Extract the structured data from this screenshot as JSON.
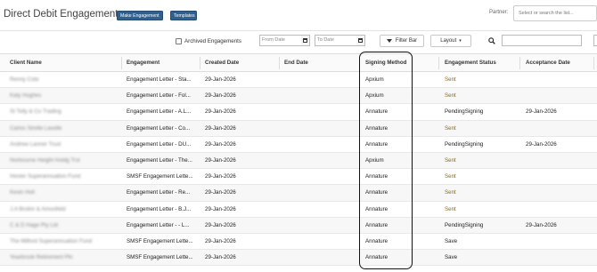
{
  "header": {
    "title": "Direct Debit Engagements",
    "make_engagement_label": "Make Engagement",
    "templates_label": "Templates",
    "partner_label": "Partner:",
    "partner_placeholder": "Select or search the list..."
  },
  "toolbar": {
    "archived_label": "Archived Engagements",
    "archived_checked": false,
    "from_date_placeholder": "From Date",
    "to_date_placeholder": "To Date",
    "filter_bar_label": "Filter Bar",
    "layout_label": "Layout",
    "search_value": ""
  },
  "table": {
    "columns": [
      "Client Name",
      "Engagement",
      "Created Date",
      "End Date",
      "Signing Method",
      "Engagement Status",
      "Acceptance Date"
    ],
    "rows": [
      {
        "client": "Renny Cola",
        "engagement": "Engagement Letter - Sta...",
        "created": "29-Jan-2026",
        "end": "",
        "signing": "Apxium",
        "status": "Sent",
        "acceptance": ""
      },
      {
        "client": "Katy Hughes",
        "engagement": "Engagement Letter - Fol...",
        "created": "29-Jan-2026",
        "end": "",
        "signing": "Apxium",
        "status": "Sent",
        "acceptance": ""
      },
      {
        "client": "St Tolly & Co Trading",
        "engagement": "Engagement Letter - A.L...",
        "created": "29-Jan-2026",
        "end": "",
        "signing": "Annature",
        "status": "PendingSigning",
        "acceptance": "29-Jan-2026"
      },
      {
        "client": "Carlos Strelle Lavelle",
        "engagement": "Engagement Letter - Co...",
        "created": "29-Jan-2026",
        "end": "",
        "signing": "Annature",
        "status": "Sent",
        "acceptance": ""
      },
      {
        "client": "Andrew Lanner Trust",
        "engagement": "Engagement Letter - DU...",
        "created": "29-Jan-2026",
        "end": "",
        "signing": "Annature",
        "status": "PendingSigning",
        "acceptance": "29-Jan-2026"
      },
      {
        "client": "Norbourne Height Holdg Trst",
        "engagement": "Engagement Letter - The...",
        "created": "29-Jan-2026",
        "end": "",
        "signing": "Apxium",
        "status": "Sent",
        "acceptance": ""
      },
      {
        "client": "Hester Superannuation Fund",
        "engagement": "SMSF Engagement Lette...",
        "created": "29-Jan-2026",
        "end": "",
        "signing": "Annature",
        "status": "Sent",
        "acceptance": ""
      },
      {
        "client": "Kevin Holl",
        "engagement": "Engagement Letter - Re...",
        "created": "29-Jan-2026",
        "end": "",
        "signing": "Annature",
        "status": "Sent",
        "acceptance": ""
      },
      {
        "client": "J.A Brolinr & Amosfield",
        "engagement": "Engagement Letter - B.J...",
        "created": "29-Jan-2026",
        "end": "",
        "signing": "Annature",
        "status": "Sent",
        "acceptance": ""
      },
      {
        "client": "C & D Hage Pty Ltd",
        "engagement": "Engagement Letter - - L...",
        "created": "29-Jan-2026",
        "end": "",
        "signing": "Annature",
        "status": "PendingSigning",
        "acceptance": "29-Jan-2026"
      },
      {
        "client": "The Milford Superannuation Fund",
        "engagement": "SMSF Engagement Lette...",
        "created": "29-Jan-2026",
        "end": "",
        "signing": "Annature",
        "status": "Save",
        "acceptance": ""
      },
      {
        "client": "Yearbrook Retirement Pln",
        "engagement": "SMSF Engagement Lette...",
        "created": "29-Jan-2026",
        "end": "",
        "signing": "Annature",
        "status": "Save",
        "acceptance": ""
      }
    ]
  },
  "colors": {
    "button_bg": "#2f6190",
    "sent_status": "#8a6a1e",
    "highlight_border": "#111111"
  }
}
